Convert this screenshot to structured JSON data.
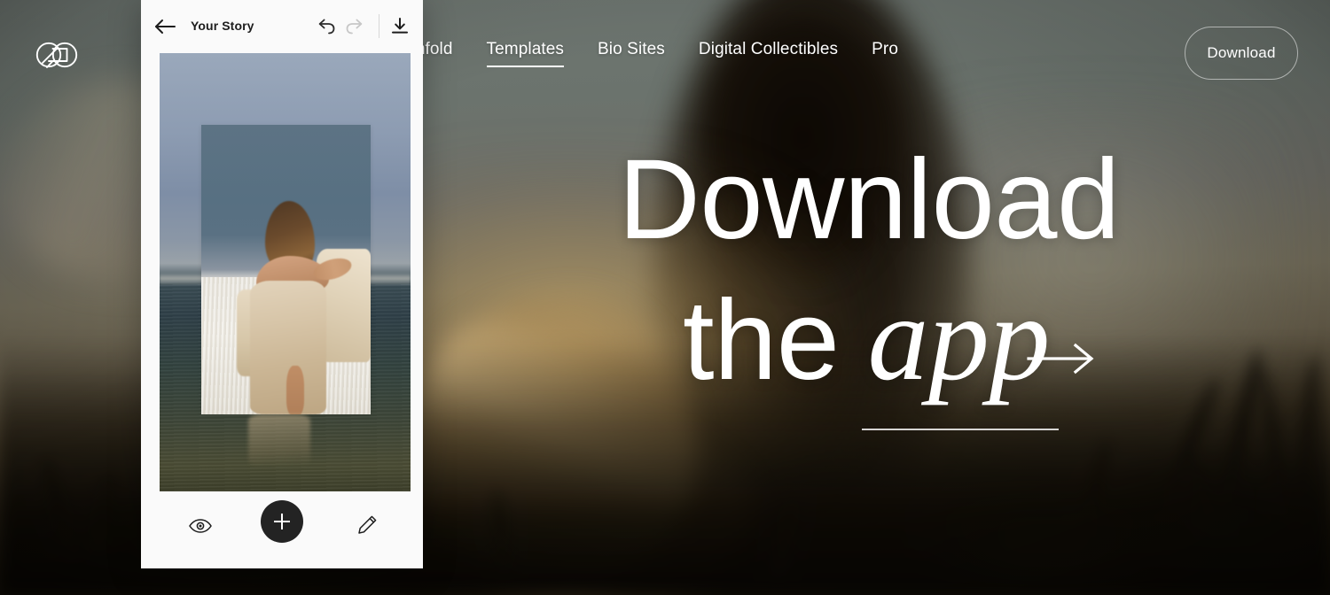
{
  "brand": {
    "logo_name": "unfold-logo",
    "logo_alt": "Unfold"
  },
  "nav": {
    "links": [
      {
        "label": "Unfold",
        "active": false,
        "name": "nav-link-unfold"
      },
      {
        "label": "Templates",
        "active": true,
        "name": "nav-link-templates"
      },
      {
        "label": "Bio Sites",
        "active": false,
        "name": "nav-link-bio-sites"
      },
      {
        "label": "Digital Collectibles",
        "active": false,
        "name": "nav-link-digital-collectibles"
      },
      {
        "label": "Pro",
        "active": false,
        "name": "nav-link-pro"
      }
    ],
    "download_button": "Download"
  },
  "hero": {
    "line1": "Download",
    "line2_prefix": "the",
    "line2_italic": "app",
    "arrow_glyph": "→",
    "arrow_name": "hero-arrow-right"
  },
  "phone": {
    "header": {
      "back_icon": "back-arrow-icon",
      "title": "Your Story",
      "undo_icon": "undo-icon",
      "redo_icon": "redo-icon",
      "redo_disabled": true,
      "export_icon": "download-icon"
    },
    "canvas": {
      "description": "Story template: woman in a beige dress at the shoreline, framed photo layered over ocean background",
      "layer_name": "template-canvas"
    },
    "toolbar": {
      "preview_icon": "eye-icon",
      "add_label": "+",
      "add_icon": "plus-icon",
      "edit_icon": "pencil-icon"
    }
  },
  "colors": {
    "panel_bg": "#fafafa",
    "text_dark": "#1d1d1d",
    "accent_button": "#232323",
    "nav_text": "#ffffff",
    "divider": "#d8d8d8",
    "disabled_icon": "#c4c4c4"
  }
}
